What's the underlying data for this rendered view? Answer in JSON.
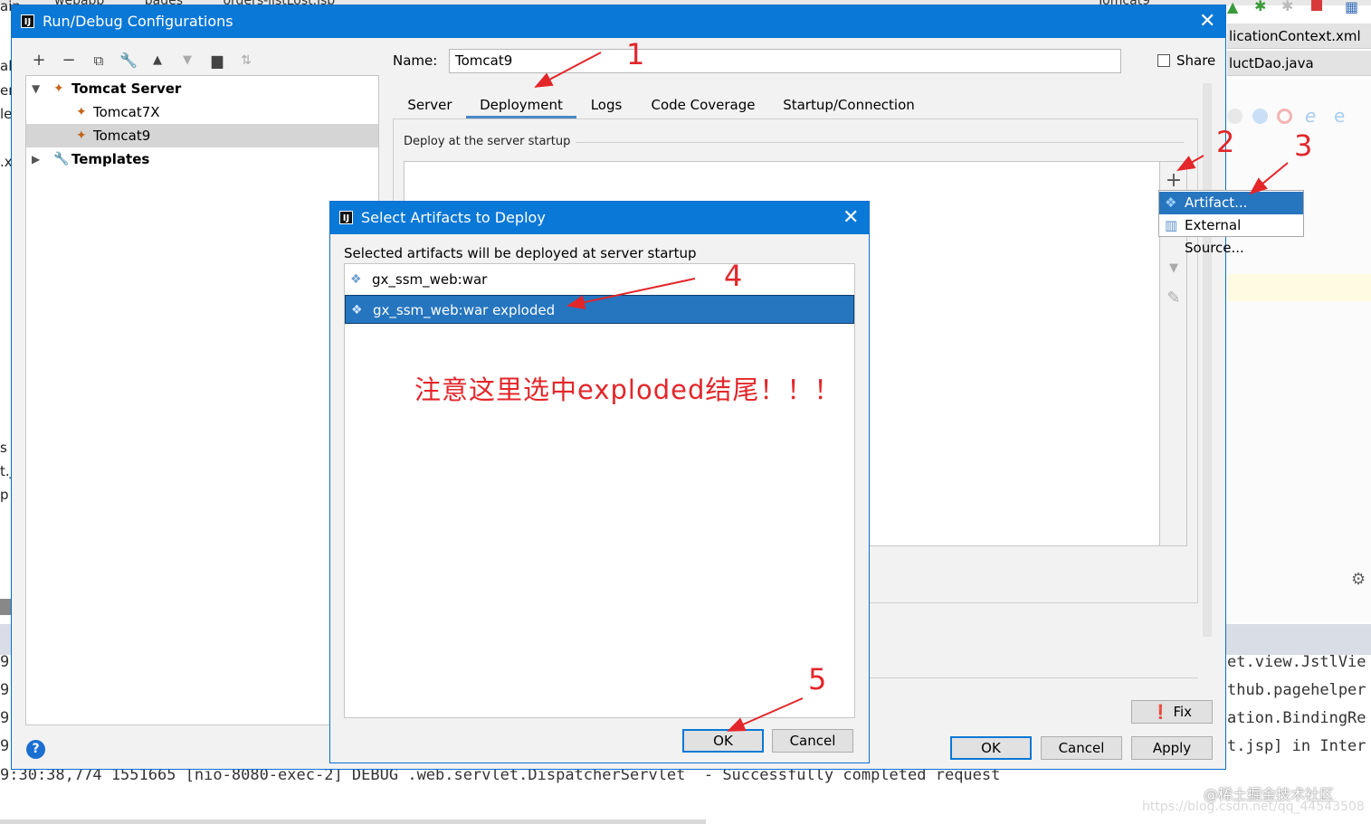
{
  "background": {
    "left_fragments": [
      "ain",
      "all",
      "er",
      "le",
      ".x",
      "s",
      "t.j",
      "p"
    ],
    "top_tabs": [
      "webapp",
      "pages",
      "orders-listLost.jsp",
      "Tomcat9"
    ],
    "right_tabs": [
      "licationContext.xml",
      "luctDao.java"
    ],
    "console_left_digits": [
      "9",
      "9",
      "9",
      "9"
    ],
    "console_right": [
      "et.view.JstlVie",
      "thub.pagehelper",
      "ation.BindingRe",
      "t.jsp] in Inter"
    ],
    "console_line": "9:30:38,774 1551665 [nio-8080-exec-2] DEBUG .web.servlet.DispatcherServlet  - Successfully completed request"
  },
  "main_dialog": {
    "title": "Run/Debug Configurations",
    "tree": {
      "group_server": "Tomcat Server",
      "item1": "Tomcat7X",
      "item2": "Tomcat9",
      "group_templates": "Templates"
    },
    "name_label": "Name:",
    "name_value": "Tomcat9",
    "share_label": "Share",
    "tabs": [
      "Server",
      "Deployment",
      "Logs",
      "Code Coverage",
      "Startup/Connection"
    ],
    "section_label": "Deploy at the server startup",
    "buttons": {
      "fix": "Fix",
      "ok": "OK",
      "cancel": "Cancel",
      "apply": "Apply"
    },
    "help": "?"
  },
  "popup_menu": {
    "items": [
      "Artifact...",
      "External Source..."
    ]
  },
  "artifact_dialog": {
    "title": "Select Artifacts to Deploy",
    "description": "Selected artifacts will be deployed at server startup",
    "items": [
      "gx_ssm_web:war",
      "gx_ssm_web:war exploded"
    ],
    "buttons": {
      "ok": "OK",
      "cancel": "Cancel"
    }
  },
  "annotations": {
    "numbers": [
      "1",
      "2",
      "3",
      "4",
      "5"
    ],
    "note": "注意这里选中exploded结尾！！！",
    "color": "#e3262a"
  },
  "watermark": "@稀土掘金技术社区",
  "url_watermark": "https://blog.csdn.net/qq_44543508",
  "colors": {
    "title_bar": "#0a78d7",
    "selection": "#2675bf",
    "annotation": "#e3262a"
  }
}
